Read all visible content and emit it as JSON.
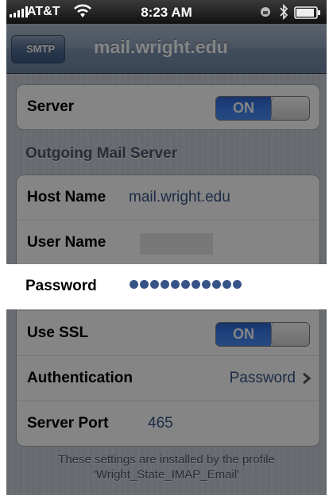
{
  "status_bar": {
    "carrier": "AT&T",
    "time": "8:23 AM",
    "icons": [
      "signal-icon",
      "wifi-icon",
      "lock-icon",
      "bluetooth-icon",
      "battery-icon"
    ]
  },
  "nav": {
    "back_label": "SMTP",
    "title": "mail.wright.edu"
  },
  "server": {
    "label": "Server",
    "toggle": "ON"
  },
  "section_header": "Outgoing Mail Server",
  "fields": {
    "host_name": {
      "label": "Host Name",
      "value": "mail.wright.edu"
    },
    "user_name": {
      "label": "User Name",
      "value": ""
    },
    "password": {
      "label": "Password",
      "masked_length": 11
    },
    "use_ssl": {
      "label": "Use SSL",
      "toggle": "ON"
    },
    "authentication": {
      "label": "Authentication",
      "value": "Password"
    },
    "server_port": {
      "label": "Server Port",
      "value": "465"
    }
  },
  "footer": {
    "line1": "These settings are installed by the profile",
    "line2": "'Wright_State_IMAP_Email'"
  },
  "colors": {
    "switch_on": "#3b7ff0",
    "value_text": "#385487",
    "nav_bar": "#7d93b0"
  }
}
